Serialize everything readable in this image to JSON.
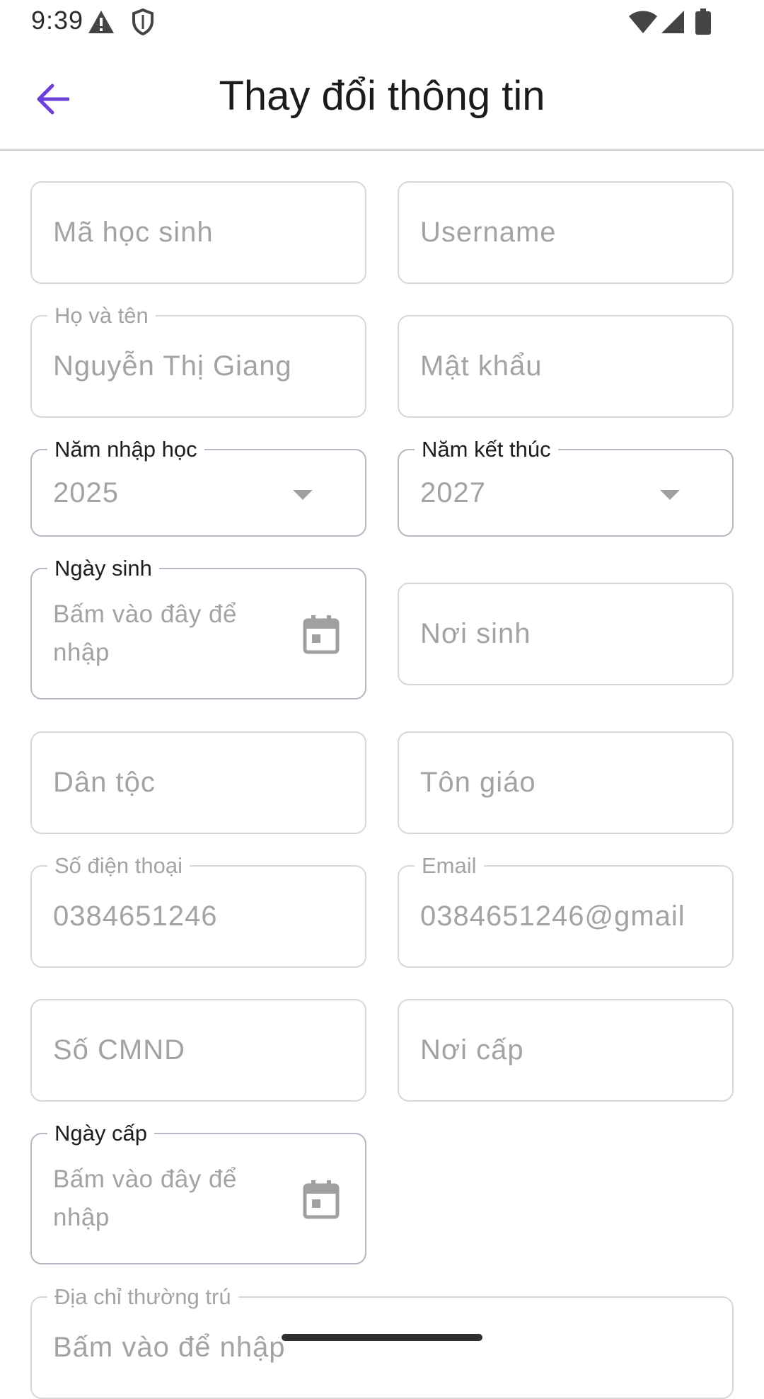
{
  "status_bar": {
    "time": "9:39",
    "left_icons": [
      "warning-icon",
      "shield-icon"
    ],
    "right_icons": [
      "wifi-icon",
      "cell-signal-icon",
      "battery-icon"
    ]
  },
  "app_bar": {
    "back_icon": "arrow-back-icon",
    "title": "Thay đổi thông tin",
    "accent_color": "#6b3fd8"
  },
  "form": {
    "ma_hoc_sinh": {
      "placeholder": "Mã học sinh"
    },
    "username": {
      "placeholder": "Username"
    },
    "ho_va_ten": {
      "label": "Họ và tên",
      "value": "Nguyễn Thị Giang"
    },
    "mat_khau": {
      "placeholder": "Mật khẩu"
    },
    "nam_nhap_hoc": {
      "label": "Năm nhập học",
      "value": "2025"
    },
    "nam_ket_thuc": {
      "label": "Năm kết thúc",
      "value": "2027"
    },
    "ngay_sinh": {
      "label": "Ngày sinh",
      "value": "Bấm vào đây để nhập"
    },
    "noi_sinh": {
      "placeholder": "Nơi sinh"
    },
    "dan_toc": {
      "placeholder": "Dân tộc"
    },
    "ton_giao": {
      "placeholder": "Tôn giáo"
    },
    "so_dien_thoai": {
      "label": "Số điện thoại",
      "value": "0384651246"
    },
    "email": {
      "label": "Email",
      "value": "0384651246@gmail"
    },
    "so_cmnd": {
      "placeholder": "Số CMND"
    },
    "noi_cap": {
      "placeholder": "Nơi cấp"
    },
    "ngay_cap": {
      "label": "Ngày cấp",
      "value": "Bấm vào đây để nhập"
    },
    "dia_chi_thuong_tru": {
      "label": "Địa chỉ thường trú",
      "value": "Bấm vào để nhập"
    }
  }
}
